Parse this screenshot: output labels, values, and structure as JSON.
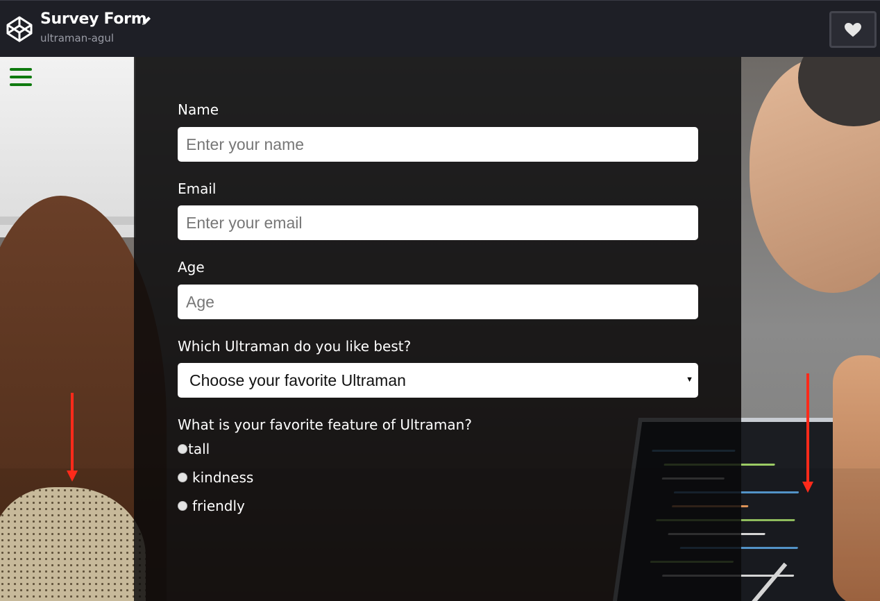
{
  "header": {
    "title": "Survey Form",
    "subtitle": "ultraman-agul",
    "icons": {
      "logo": "codepen-logo-icon",
      "edit": "pencil-icon",
      "like": "heart-icon"
    }
  },
  "menu": {
    "icon": "hamburger-menu-icon",
    "color": "#0f7a0f"
  },
  "form": {
    "name_label": "Name",
    "name_placeholder": "Enter your name",
    "email_label": "Email",
    "email_placeholder": "Enter your email",
    "age_label": "Age",
    "age_placeholder": "Age",
    "dropdown_label": "Which Ultraman do you like best?",
    "dropdown_selected": "Choose your favorite Ultraman",
    "feature_question": "What is your favorite feature of Ultraman?",
    "features": [
      "tall",
      "kindness",
      "friendly"
    ]
  },
  "annotations": {
    "arrow_color": "#ff2a1a"
  }
}
